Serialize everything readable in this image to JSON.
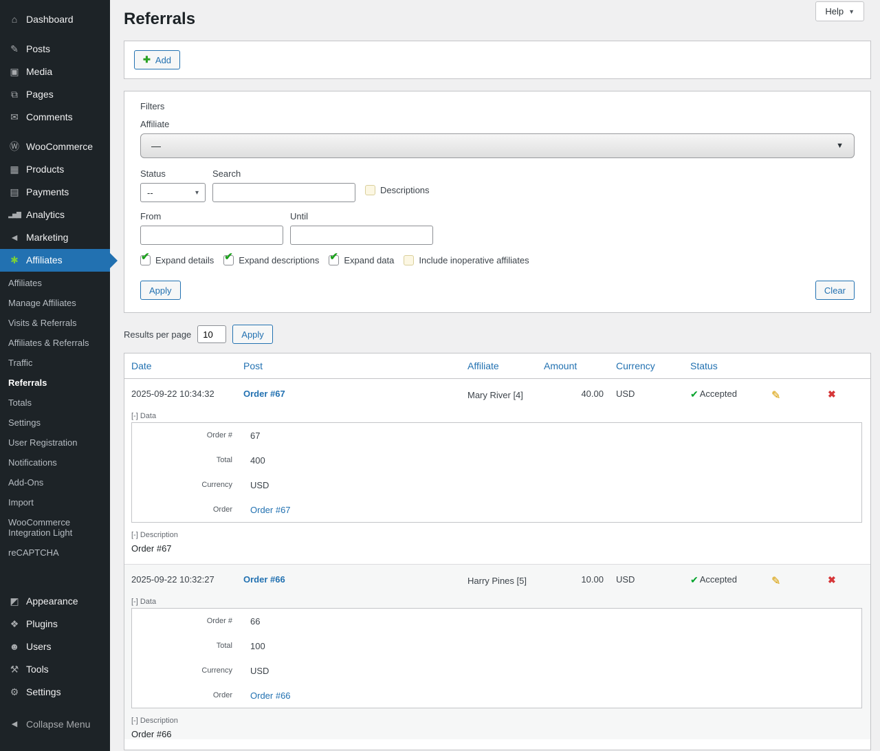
{
  "icons": {
    "dashboard": "⌂",
    "posts": "✎",
    "media": "▣",
    "pages": "⧉",
    "comments": "✉",
    "woocommerce": "Ⓦ",
    "products": "▦",
    "payments": "▤",
    "analytics": "▂▅▇",
    "marketing": "◄",
    "affiliates": "✱",
    "appearance": "◩",
    "plugins": "❖",
    "users": "☻",
    "tools": "⚒",
    "settings": "⚙",
    "collapse": "◀",
    "add_plus": "✚",
    "check": "✔",
    "status_check": "✔",
    "edit": "✎",
    "delete": "✖",
    "dropdown_arrow": "▼",
    "select_chevron": "▾",
    "help_arrow": "▼"
  },
  "sidebar": {
    "dashboard": "Dashboard",
    "posts": "Posts",
    "media": "Media",
    "pages": "Pages",
    "comments": "Comments",
    "woocommerce": "WooCommerce",
    "products": "Products",
    "payments": "Payments",
    "analytics": "Analytics",
    "marketing": "Marketing",
    "affiliates": "Affiliates",
    "submenu": [
      "Affiliates",
      "Manage Affiliates",
      "Visits & Referrals",
      "Affiliates & Referrals",
      "Traffic",
      "Referrals",
      "Totals",
      "Settings",
      "User Registration",
      "Notifications",
      "Add-Ons",
      "Import",
      "WooCommerce Integration Light",
      "reCAPTCHA"
    ],
    "appearance": "Appearance",
    "plugins": "Plugins",
    "users": "Users",
    "tools": "Tools",
    "settings": "Settings",
    "collapse": "Collapse Menu"
  },
  "header": {
    "title": "Referrals",
    "help": "Help"
  },
  "toolbar": {
    "add": "Add"
  },
  "filters": {
    "title": "Filters",
    "affiliate_label": "Affiliate",
    "affiliate_value": "—",
    "status_label": "Status",
    "status_value": "--",
    "search_label": "Search",
    "search_value": "",
    "descriptions_label": "Descriptions",
    "descriptions_checked": false,
    "from_label": "From",
    "from_value": "",
    "until_label": "Until",
    "until_value": "",
    "expand_details_label": "Expand details",
    "expand_details_checked": true,
    "expand_descriptions_label": "Expand descriptions",
    "expand_descriptions_checked": true,
    "expand_data_label": "Expand data",
    "expand_data_checked": true,
    "include_inoperative_label": "Include inoperative affiliates",
    "include_inoperative_checked": false,
    "apply": "Apply",
    "clear": "Clear"
  },
  "results_bar": {
    "label": "Results per page",
    "value": "10",
    "apply": "Apply"
  },
  "table": {
    "columns": [
      "Date",
      "Post",
      "Affiliate",
      "Amount",
      "Currency",
      "Status"
    ],
    "data_toggle": "[-] Data",
    "description_toggle": "[-] Description",
    "rows": [
      {
        "date": "2025-09-22 10:34:32",
        "post": "Order #67",
        "affiliate": "Mary River [4]",
        "amount": "40.00",
        "currency": "USD",
        "status": "Accepted",
        "data": [
          {
            "label": "Order #",
            "value": "67"
          },
          {
            "label": "Total",
            "value": "400"
          },
          {
            "label": "Currency",
            "value": "USD"
          },
          {
            "label": "Order",
            "value": "Order #67"
          }
        ],
        "description": "Order #67"
      },
      {
        "date": "2025-09-22 10:32:27",
        "post": "Order #66",
        "affiliate": "Harry Pines [5]",
        "amount": "10.00",
        "currency": "USD",
        "status": "Accepted",
        "data": [
          {
            "label": "Order #",
            "value": "66"
          },
          {
            "label": "Total",
            "value": "100"
          },
          {
            "label": "Currency",
            "value": "USD"
          },
          {
            "label": "Order",
            "value": "Order #66"
          }
        ],
        "description": "Order #66"
      }
    ]
  }
}
